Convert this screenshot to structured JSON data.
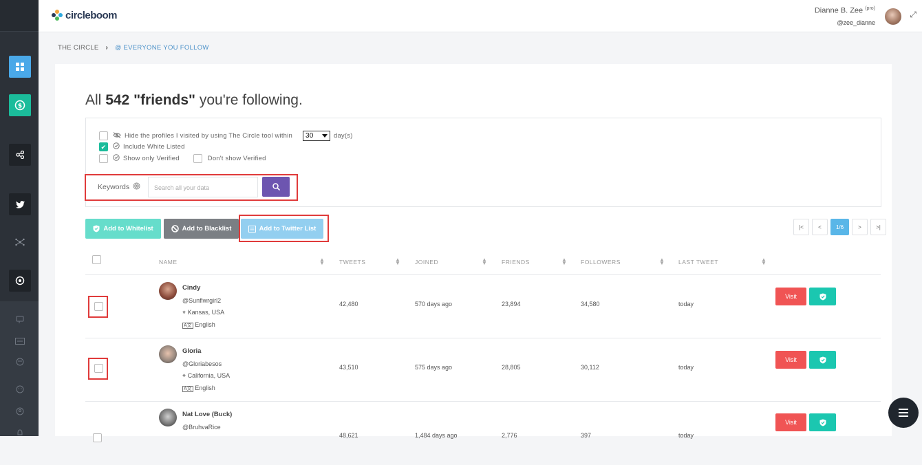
{
  "app": {
    "logo_text": "circleboom"
  },
  "user": {
    "name": "Dianne B. Zee",
    "tier": "(pro)",
    "handle": "@zee_dianne"
  },
  "breadcrumb": {
    "root": "THE CIRCLE",
    "current": "EVERYONE YOU FOLLOW"
  },
  "heading": {
    "prefix": "All",
    "count": "542",
    "quoted": "\"friends\"",
    "suffix": "you're following."
  },
  "filters": {
    "hide_visited_label": "Hide the profiles I visited by using The Circle tool within",
    "days_value": "30",
    "days_unit": "day(s)",
    "include_whitelisted_label": "Include White Listed",
    "include_whitelisted_checked": true,
    "only_verified_label": "Show only Verified",
    "dont_show_verified_label": "Don't show Verified",
    "keywords_label": "Keywords",
    "search_placeholder": "Search all your data"
  },
  "actions": {
    "whitelist_label": "Add to Whitelist",
    "blacklist_label": "Add to Blacklist",
    "twitter_list_label": "Add to Twitter List"
  },
  "pagination": {
    "first": "|<",
    "prev": "<",
    "current": "1/6",
    "next": ">",
    "last": ">|"
  },
  "table": {
    "columns": [
      "NAME",
      "TWEETS",
      "JOINED",
      "FRIENDS",
      "FOLLOWERS",
      "LAST TWEET"
    ],
    "visit_label": "Visit",
    "rows": [
      {
        "name": "Cindy",
        "handle": "@Sunflwrgirl2",
        "location": "Kansas, USA",
        "language": "English",
        "tweets": "42,480",
        "joined": "570 days ago",
        "friends": "23,894",
        "followers": "34,580",
        "last_tweet": "today"
      },
      {
        "name": "Gloria",
        "handle": "@Gloriabesos",
        "location": "California, USA",
        "language": "English",
        "tweets": "43,510",
        "joined": "575 days ago",
        "friends": "28,805",
        "followers": "30,112",
        "last_tweet": "today"
      },
      {
        "name": "Nat Love (Buck)",
        "handle": "@BruhvaRice",
        "location": "",
        "language": "",
        "tweets": "48,621",
        "joined": "1,484 days ago",
        "friends": "2,776",
        "followers": "397",
        "last_tweet": "today"
      }
    ]
  },
  "colors": {
    "accent_teal": "#1bbc9b",
    "search_purple": "#6d55b0",
    "visit_red": "#f05454",
    "highlight_red": "#e03b3b",
    "link_blue": "#4a90c8"
  }
}
